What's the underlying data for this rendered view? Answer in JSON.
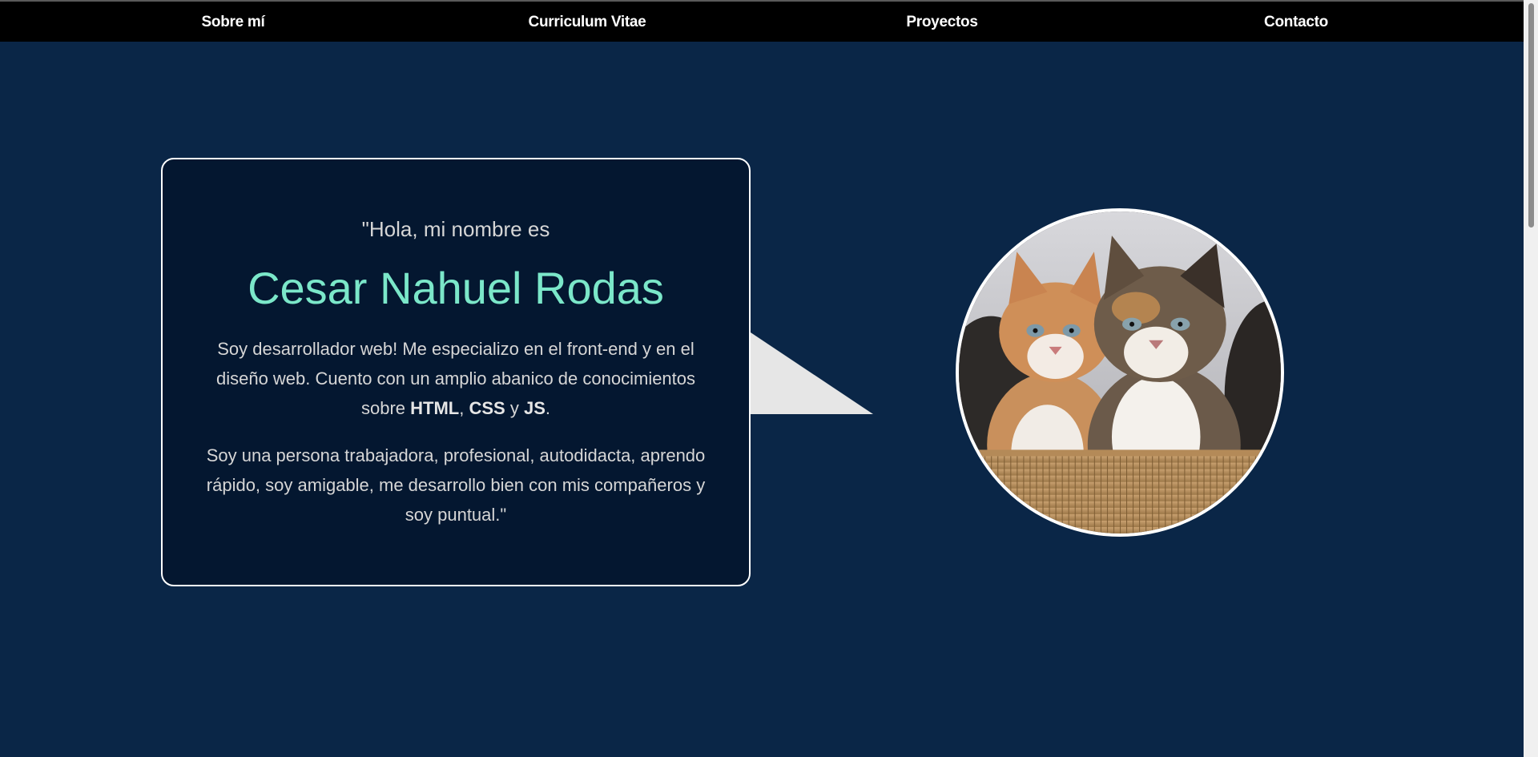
{
  "nav": {
    "items": [
      {
        "label": "Sobre mí"
      },
      {
        "label": "Curriculum Vitae"
      },
      {
        "label": "Proyectos"
      },
      {
        "label": "Contacto"
      }
    ]
  },
  "hero": {
    "greeting": "\"Hola, mi nombre es",
    "name": "Cesar Nahuel Rodas",
    "paragraph1": {
      "text_before": "Soy desarrollador web! Me especializo en el front-end y en el diseño web. Cuento con un amplio abanico de conocimientos sobre ",
      "tech1": "HTML",
      "sep1": ", ",
      "tech2": "CSS",
      "sep2": " y ",
      "tech3": "JS",
      "text_after": "."
    },
    "paragraph2": "Soy una persona trabajadora, profesional, autodidacta, aprendo rápido, soy amigable, me desarrollo bien con mis compañeros y soy puntual.\""
  },
  "avatar": {
    "icon": "kittens-photo"
  },
  "colors": {
    "page_background": "#0a2647",
    "nav_background": "#000000",
    "bubble_background": "#041730",
    "name_accent": "#7be7c9",
    "body_text": "#d6d6d6",
    "pointer_fill": "#e6e6e6"
  }
}
